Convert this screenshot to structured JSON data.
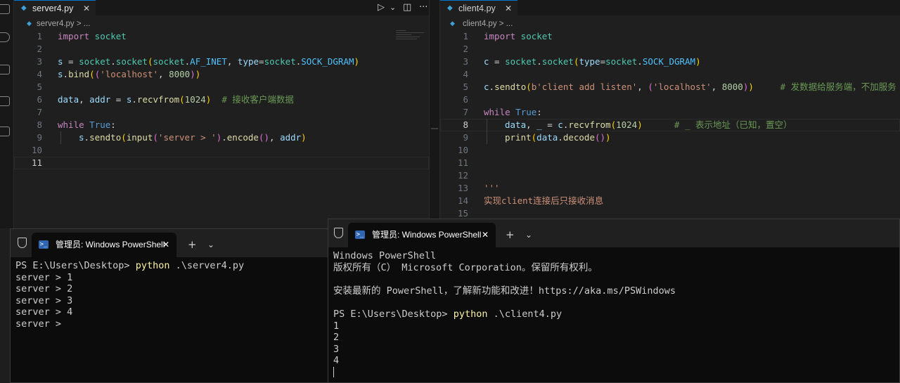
{
  "colors": {
    "editor_bg": "#1f1f1f",
    "terminal_bg": "#0c0c0c",
    "active_tab_border": "#0078d4",
    "python_icon": "#3fa0d8",
    "ps_icon": "#2f66b3"
  },
  "left_editor": {
    "tab_label": "server4.py",
    "tab_close": "✕",
    "breadcrumb": "server4.py > ...",
    "lines": {
      "l1": {
        "n": "1",
        "t1": "import",
        "t2": " socket"
      },
      "l2": {
        "n": "2"
      },
      "l3": {
        "n": "3",
        "t1": "s",
        "t2": " = ",
        "t3": "socket",
        "t4": ".",
        "t5": "socket",
        "t6": "(",
        "t7": "socket",
        "t8": ".",
        "t9": "AF_INET",
        "t10": ", ",
        "t11": "type",
        "t12": "=",
        "t13": "socket",
        "t14": ".",
        "t15": "SOCK_DGRAM",
        "t16": ")"
      },
      "l4": {
        "n": "4",
        "t1": "s",
        "t2": ".",
        "t3": "bind",
        "t4": "(",
        "t5": "(",
        "t6": "'localhost'",
        "t7": ", ",
        "t8": "8000",
        "t9": ")",
        "t10": ")"
      },
      "l5": {
        "n": "5"
      },
      "l6": {
        "n": "6",
        "t1": "data",
        "t2": ", ",
        "t3": "addr",
        "t4": " = ",
        "t5": "s",
        "t6": ".",
        "t7": "recvfrom",
        "t8": "(",
        "t9": "1024",
        "t10": ")",
        "t11": "  # 接收客户端数据"
      },
      "l7": {
        "n": "7"
      },
      "l8": {
        "n": "8",
        "t1": "while",
        "t2": " ",
        "t3": "True",
        "t4": ":"
      },
      "l9": {
        "n": "9",
        "t1": "s",
        "t2": ".",
        "t3": "sendto",
        "t4": "(",
        "t5": "input",
        "t6": "(",
        "t7": "'server > '",
        "t8": ")",
        "t9": ".",
        "t10": "encode",
        "t11": "()",
        "t12": ", ",
        "t13": "addr",
        "t14": ")"
      },
      "l10": {
        "n": "10"
      },
      "l11": {
        "n": "11"
      }
    }
  },
  "right_editor": {
    "tab_label": "client4.py",
    "tab_close": "✕",
    "breadcrumb": "client4.py > ...",
    "lines": {
      "l1": {
        "n": "1",
        "t1": "import",
        "t2": " socket"
      },
      "l2": {
        "n": "2"
      },
      "l3": {
        "n": "3",
        "t1": "c",
        "t2": " = ",
        "t3": "socket",
        "t4": ".",
        "t5": "socket",
        "t6": "(",
        "t7": "type",
        "t8": "=",
        "t9": "socket",
        "t10": ".",
        "t11": "SOCK_DGRAM",
        "t12": ")"
      },
      "l4": {
        "n": "4"
      },
      "l5": {
        "n": "5",
        "t1": "c",
        "t2": ".",
        "t3": "sendto",
        "t4": "(",
        "t5": "b'client add listen'",
        "t6": ", ",
        "t7": "(",
        "t8": "'localhost'",
        "t9": ", ",
        "t10": "8000",
        "t11": ")",
        "t12": ")",
        "t13": "     # 发数据给服务端，不加服务"
      },
      "l6": {
        "n": "6"
      },
      "l7": {
        "n": "7",
        "t1": "while",
        "t2": " ",
        "t3": "True",
        "t4": ":"
      },
      "l8": {
        "n": "8",
        "t1": "data",
        "t2": ", ",
        "t3": "_",
        "t4": " = ",
        "t5": "c",
        "t6": ".",
        "t7": "recvfrom",
        "t8": "(",
        "t9": "1024",
        "t10": ")",
        "t11": "      # _ 表示地址（已知，置空）"
      },
      "l9": {
        "n": "9",
        "t1": "print",
        "t2": "(",
        "t3": "data",
        "t4": ".",
        "t5": "decode",
        "t6": "()",
        "t7": ")"
      },
      "l10": {
        "n": "10"
      },
      "l11": {
        "n": "11"
      },
      "l12": {
        "n": "12"
      },
      "l13": {
        "n": "13",
        "t1": "'''"
      },
      "l14": {
        "n": "14",
        "t1": "实现client连接后只接收消息"
      },
      "l15": {
        "n": "15"
      }
    }
  },
  "toolbar": {
    "run": "▷",
    "run_menu": "⌄",
    "split": "◫",
    "more": "···"
  },
  "ps_left": {
    "tab_label": "管理员: Windows PowerShell",
    "tab_close": "✕",
    "new_tab": "+",
    "dropdown": "⌄",
    "prompt": "PS E:\\Users\\Desktop> ",
    "cmd": "python",
    "arg": " .\\server4.py",
    "out1": "server > 1",
    "out2": "server > 2",
    "out3": "server > 3",
    "out4": "server > 4",
    "out5": "server > "
  },
  "ps_right": {
    "tab_label": "管理员: Windows PowerShell",
    "tab_close": "✕",
    "new_tab": "+",
    "dropdown": "⌄",
    "banner1": "Windows PowerShell",
    "banner2": "版权所有（C） Microsoft Corporation。保留所有权利。",
    "banner3": "安装最新的 PowerShell，了解新功能和改进！https://aka.ms/PSWindows",
    "prompt": "PS E:\\Users\\Desktop> ",
    "cmd": "python",
    "arg": " .\\client4.py",
    "out1": "1",
    "out2": "2",
    "out3": "3",
    "out4": "4"
  },
  "icons": [
    "python-file-icon",
    "run-icon",
    "split-editor-icon",
    "more-actions-icon",
    "shield-icon",
    "powershell-icon",
    "close-icon",
    "plus-icon",
    "chevron-down-icon"
  ]
}
